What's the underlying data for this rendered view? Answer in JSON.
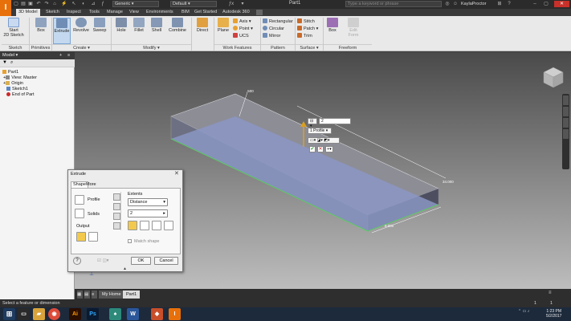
{
  "titlebar": {
    "logo": "I",
    "material": "Generic",
    "appearance": "Default",
    "filename": "Part1",
    "search_placeholder": "Type a keyword or phrase",
    "user": "KaylaProctor"
  },
  "tabs": [
    "3D Model",
    "Sketch",
    "Inspect",
    "Tools",
    "Manage",
    "View",
    "Environments",
    "BIM",
    "Get Started",
    "Autodesk 360"
  ],
  "ribbon": {
    "start_sketch": [
      "Start",
      "2D Sketch"
    ],
    "box": "Box",
    "extrude": "Extrude",
    "revolve": "Revolve",
    "sweep": "Sweep",
    "hole": "Hole",
    "fillet": "Fillet",
    "shell": "Shell",
    "combine": "Combine",
    "direct": "Direct",
    "plane": "Plane",
    "axis": "Axis",
    "point": "Point",
    "ucs": "UCS",
    "rectangular": "Rectangular",
    "circular": "Circular",
    "mirror": "Mirror",
    "stitch": "Stitch",
    "patch": "Patch",
    "trim": "Trim",
    "freeform_box": "Box",
    "edit_form": [
      "Edit",
      "Form"
    ],
    "panels": [
      "Sketch",
      "Primitives",
      "Create ▾",
      "Modify ▾",
      "Work Features",
      "Pattern",
      "Surface ▾",
      "Freeform"
    ]
  },
  "browser": {
    "title": "Model ▾",
    "items": [
      "Part1",
      "View: Master",
      "Origin",
      "Sketch1",
      "End of Part"
    ]
  },
  "viewport": {
    "dim_top": ".500",
    "dim_right": "34.000",
    "dim_bottom": "8.000",
    "distance_value": "2",
    "profile_label": "1 Profile"
  },
  "dialog": {
    "title": "Extrude",
    "tabs": [
      "Shape",
      "More"
    ],
    "profile": "Profile",
    "solids": "Solids",
    "output": "Output",
    "extents": "Extents",
    "extents_mode": "Distance",
    "distance": "2",
    "match_shape": "Match shape",
    "ok": "OK",
    "cancel": "Cancel"
  },
  "doc_tabs": [
    "My Home",
    "Part1"
  ],
  "status": "Select a feature or dimension",
  "taskbar": {
    "time": "1:23 PM",
    "date": "5/2/2017"
  },
  "colors": {
    "accent": "#e8700a",
    "highlight_edge": "#4fdc4f"
  }
}
